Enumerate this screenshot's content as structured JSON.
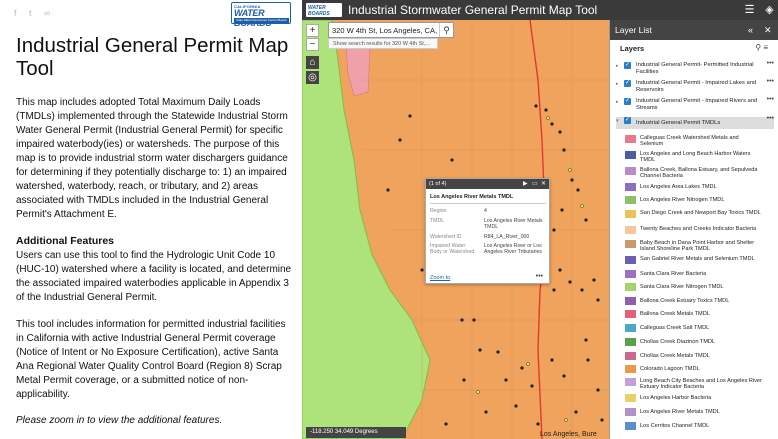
{
  "left_panel": {
    "share_icons": [
      "facebook-icon",
      "twitter-icon",
      "link-icon"
    ],
    "logo": {
      "line1": "CALIFORNIA",
      "line2": "WATER BOARDS",
      "line3": "State Water Resources Control Board"
    },
    "title": "Industrial General Permit Map Tool",
    "description": "This map includes adopted Total Maximum Daily Loads (TMDLs) implemented through the Statewide Industrial Storm Water General Permit (Industrial General Permit) for specific impaired waterbody(ies) or watersheds. The purpose of this map is to provide industrial storm water dischargers guidance for determining if they potentially discharge to: 1) an impaired watershed, waterbody, reach, or tributary, and 2) areas associated with TMDLs included in the Industrial General Permit's Attachment E.",
    "features_heading": "Additional Features",
    "features_text": "Users can use this tool to find the Hydrologic Unit Code 10 (HUC-10) watershed where a facility is located, and determine the associated impaired waterbodies applicable in Appendix 3 of the Industrial General Permit.",
    "tool_text": "This tool includes information for permitted industrial facilities in California with active Industrial General Permit coverage (Notice of Intent or No Exposure Certification), active Santa Ana Regional Water Quality Control Board (Region 8) Scrap Metal Permit coverage, or a submitted notice of non-applicability.",
    "zoom_note": "Please zoom in to view the additional features."
  },
  "map_header": {
    "logo_text": "WATER BOARDS",
    "title": "Industrial Stormwater General Permit Map Tool",
    "icons": [
      "list-icon",
      "menu-icon",
      "layers-icon"
    ]
  },
  "search": {
    "value": "320 W 4th St, Los Angeles, CA, 9",
    "suggestion": "Show search results for 320 W 4th St,..."
  },
  "map_controls": {
    "zoom_in": "+",
    "zoom_out": "−",
    "home": "⌂",
    "locate": "◎"
  },
  "popup": {
    "counter": "(1 of 4)",
    "title": "Los Angeles River Metals TMDL",
    "rows": [
      {
        "key": "Region",
        "value": "4"
      },
      {
        "key": "TMDL",
        "value": "Los Angeles River Metals TMDL"
      },
      {
        "key": "Watershed ID",
        "value": "R84_LA_River_000"
      },
      {
        "key": "Impaired Water Body or Watershed",
        "value": "Los Angeles River or Los Angeles River Tributaries"
      }
    ],
    "zoom_link": "Zoom to",
    "more": "•••"
  },
  "coords": {
    "text": "-118.250 34.049 Degrees",
    "map_label": "Los Angeles, Bure"
  },
  "layer_list": {
    "title": "Layer List",
    "subtitle": "Layers",
    "top_layers": [
      {
        "label": "Industrial General Permit- Permitted Industrial Facilities",
        "selected": false
      },
      {
        "label": "Industrial General Permit - Impaired Lakes and Reservoirs",
        "selected": false
      },
      {
        "label": "Industrial General Permit - Impaired Rivers and Streams",
        "selected": false
      },
      {
        "label": "Industrial General Permit TMDLs",
        "selected": true
      }
    ],
    "tmdl_legend": [
      {
        "label": "Calleguas Creek Watershed Metals and Selenium",
        "color": "#e8798a"
      },
      {
        "label": "Los Angeles and Long Beach Harbor Waters TMDL",
        "color": "#4a5e9e"
      },
      {
        "label": "Ballona Creek, Ballona Estuary, and Sepulveda Channel Bacteria",
        "color": "#b98bc9"
      },
      {
        "label": "Los Angeles Area Lakes TMDL",
        "color": "#8a6fc2"
      },
      {
        "label": "Los Angeles River Nitrogen TMDL",
        "color": "#8fbf6a"
      },
      {
        "label": "San Diego Creek and Newport Bay Toxics TMDL",
        "color": "#e8c45b"
      },
      {
        "label": "Twenty Beaches and Creeks Indicator Bacteria",
        "color": "#f3c99a"
      },
      {
        "label": "Baby Beach in Dana Point Harbor and Shelter Island Shoreline Park TMDL",
        "color": "#c99a6e"
      },
      {
        "label": "San Gabriel River Metals and Selenium TMDL",
        "color": "#6a5fb0"
      },
      {
        "label": "Santa Clara River Bacteria",
        "color": "#9c6fc2"
      },
      {
        "label": "Santa Clara River Nitrogen TMDL",
        "color": "#a6d36a"
      },
      {
        "label": "Ballona Creek Estuary Toxics TMDL",
        "color": "#8f5fa8"
      },
      {
        "label": "Ballona Creek Metals TMDL",
        "color": "#e2607a"
      },
      {
        "label": "Calleguas Creek Salt TMDL",
        "color": "#4aa8c8"
      },
      {
        "label": "Chollas Creek Diazinon TMDL",
        "color": "#5e9e4a"
      },
      {
        "label": "Chollas Creek Metals TMDL",
        "color": "#c96a8a"
      },
      {
        "label": "Colorado Lagoon TMDL",
        "color": "#e89a4a"
      },
      {
        "label": "Long Beach City Beaches and Los Angeles River Estuary Indicator Bacteria",
        "color": "#c2a0d8"
      },
      {
        "label": "Los Angeles Harbor Bacteria",
        "color": "#e8d06a"
      },
      {
        "label": "Los Angeles River Metals TMDL",
        "color": "#b58fc8"
      },
      {
        "label": "Los Cerritos Channel TMDL",
        "color": "#5b8fc9"
      }
    ]
  }
}
